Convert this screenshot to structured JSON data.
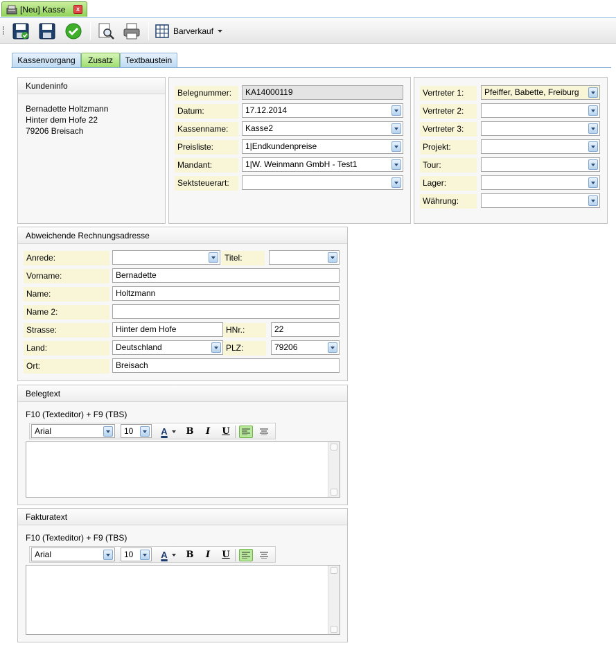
{
  "window_tab": {
    "title": "[Neu] Kasse",
    "close": "x"
  },
  "toolbar": {
    "barverkauf_label": "Barverkauf"
  },
  "tabs": [
    {
      "label": "Kassenvorgang"
    },
    {
      "label": "Zusatz"
    },
    {
      "label": "Textbaustein"
    }
  ],
  "kundeninfo": {
    "header": "Kundeninfo",
    "lines": [
      "Bernadette Holtzmann",
      "Hinter dem Hofe  22",
      "79206 Breisach"
    ]
  },
  "beleg": {
    "belegnummer_label": "Belegnummer:",
    "belegnummer_value": "KA14000119",
    "datum_label": "Datum:",
    "datum_value": "17.12.2014",
    "kassenname_label": "Kassenname:",
    "kassenname_value": "Kasse2",
    "preisliste_label": "Preisliste:",
    "preisliste_value": "1|Endkundenpreise",
    "mandant_label": "Mandant:",
    "mandant_value": "1|W. Weinmann GmbH - Test1",
    "sektsteuerart_label": "Sektsteuerart:",
    "sektsteuerart_value": ""
  },
  "vertreter": {
    "v1_label": "Vertreter 1:",
    "v1_value": "Pfeiffer, Babette, Freiburg",
    "v2_label": "Vertreter 2:",
    "v2_value": "",
    "v3_label": "Vertreter 3:",
    "v3_value": "",
    "projekt_label": "Projekt:",
    "projekt_value": "",
    "tour_label": "Tour:",
    "tour_value": "",
    "lager_label": "Lager:",
    "lager_value": "",
    "waehrung_label": "Währung:",
    "waehrung_value": ""
  },
  "adresse": {
    "header": "Abweichende Rechnungsadresse",
    "anrede_label": "Anrede:",
    "anrede_value": "",
    "titel_label": "Titel:",
    "titel_value": "",
    "vorname_label": "Vorname:",
    "vorname_value": "Bernadette",
    "name_label": "Name:",
    "name_value": "Holtzmann",
    "name2_label": "Name 2:",
    "name2_value": "",
    "strasse_label": "Strasse:",
    "strasse_value": "Hinter dem Hofe",
    "hnr_label": "HNr.:",
    "hnr_value": "22",
    "land_label": "Land:",
    "land_value": "Deutschland",
    "plz_label": "PLZ:",
    "plz_value": "79206",
    "ort_label": "Ort:",
    "ort_value": "Breisach"
  },
  "belegtext": {
    "header": "Belegtext",
    "hint": "F10 (Texteditor) + F9 (TBS)",
    "font": "Arial",
    "size": "10",
    "bold": "B",
    "italic": "I",
    "underline": "U",
    "color": "A"
  },
  "fakturatext": {
    "header": "Fakturatext",
    "hint": "F10 (Texteditor) + F9 (TBS)",
    "font": "Arial",
    "size": "10",
    "bold": "B",
    "italic": "I",
    "underline": "U",
    "color": "A"
  }
}
